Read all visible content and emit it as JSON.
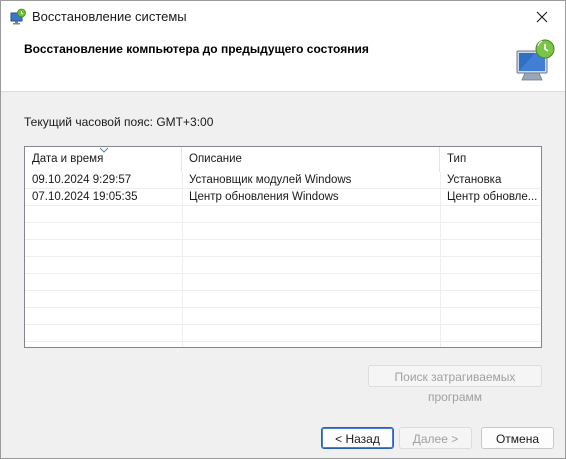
{
  "window": {
    "title": "Восстановление системы"
  },
  "header": {
    "title": "Восстановление компьютера до предыдущего состояния"
  },
  "timezone_label": "Текущий часовой пояс: GMT+3:00",
  "table": {
    "columns": [
      "Дата и время",
      "Описание",
      "Тип"
    ],
    "rows": [
      {
        "date": "09.10.2024 9:29:57",
        "description": "Установщик модулей Windows",
        "type": "Установка"
      },
      {
        "date": "07.10.2024 19:05:35",
        "description": "Центр обновления Windows",
        "type": "Центр обновле..."
      }
    ]
  },
  "buttons": {
    "scan": "Поиск затрагиваемых программ",
    "back": "< Назад",
    "next": "Далее >",
    "cancel": "Отмена"
  }
}
